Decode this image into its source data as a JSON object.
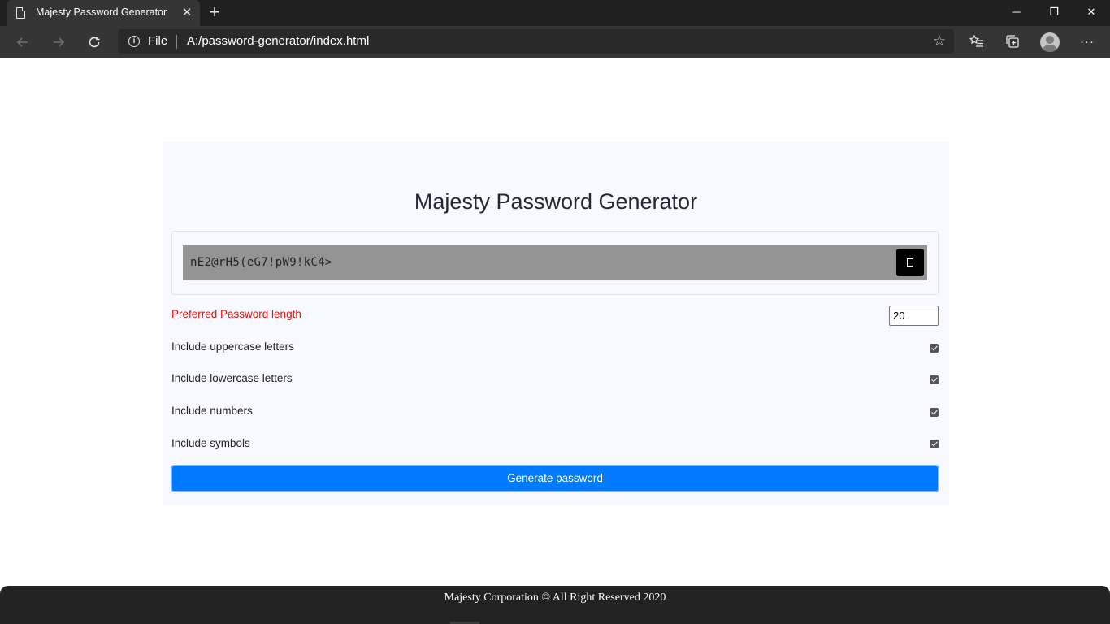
{
  "browser": {
    "tab_title": "Majesty Password Generator",
    "tab_close": "✕",
    "new_tab": "+",
    "scheme_label": "File",
    "url": "A:/password-generator/index.html",
    "window_controls": {
      "minimize": "─",
      "restore": "❐",
      "close": "✕"
    },
    "icons": [
      "page-icon",
      "back-arrow-icon",
      "forward-arrow-icon",
      "refresh-icon",
      "info-icon",
      "star-icon",
      "favorites-icon",
      "collections-icon",
      "profile-avatar-icon",
      "more-icon"
    ]
  },
  "app": {
    "title": "Majesty Password Generator",
    "password": "nE2@rH5(eG7!pW9!kC4>",
    "copy_icon": "copy-icon",
    "length_label": "Preferred Password length",
    "length_value": "20",
    "options": [
      {
        "label": "Include uppercase letters",
        "checked": true
      },
      {
        "label": "Include lowercase letters",
        "checked": true
      },
      {
        "label": "Include numbers",
        "checked": true
      },
      {
        "label": "Include symbols",
        "checked": true
      }
    ],
    "generate_button": "Generate password",
    "colors": {
      "accent": "#007bff",
      "length_label": "#e3120b",
      "card_bg": "#f8f8ff",
      "result_bg": "#949494"
    }
  },
  "footer": {
    "text": "Majesty Corporation © All Right Reserved 2020"
  }
}
